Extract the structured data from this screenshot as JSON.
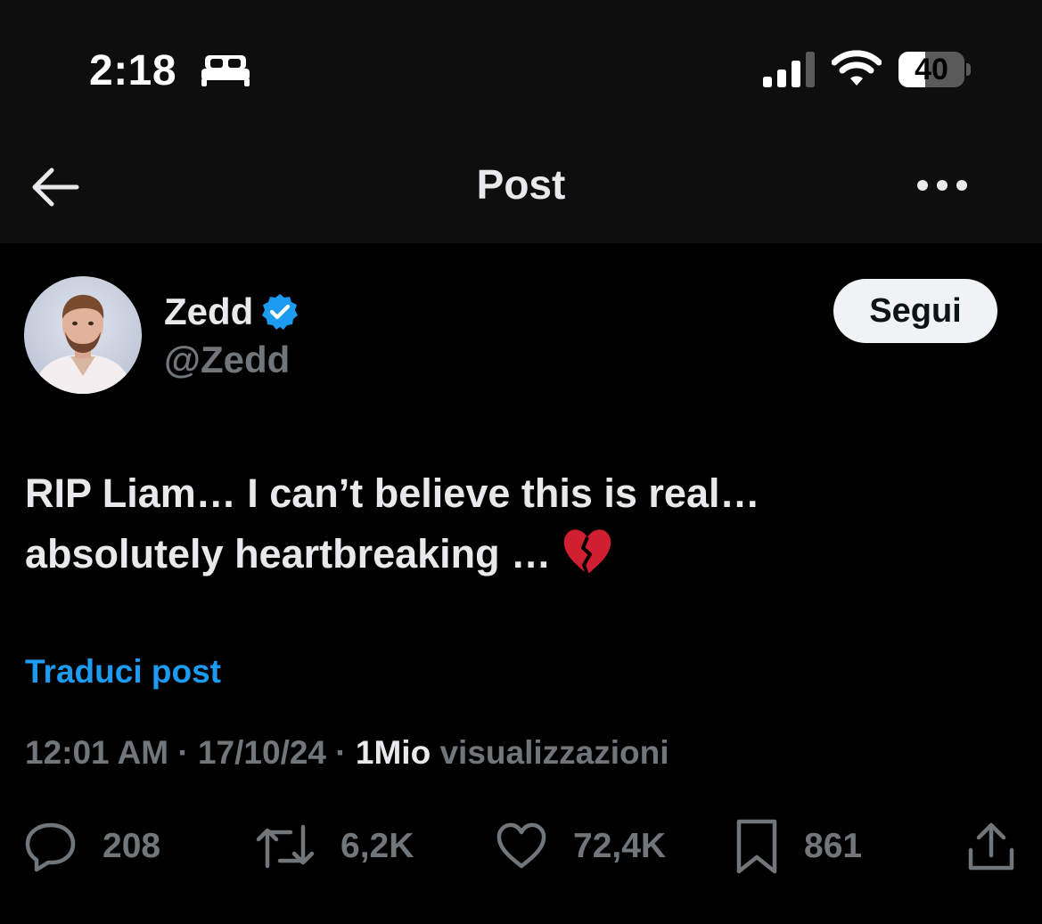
{
  "status_bar": {
    "time": "2:18",
    "focus_icon": "bed-icon",
    "signal_icon": "signal-bars-icon",
    "wifi_icon": "wifi-icon",
    "battery_level": "40",
    "battery_fraction": 0.4
  },
  "header": {
    "title": "Post",
    "back_icon": "arrow-left-icon",
    "more_icon": "more-horizontal-icon"
  },
  "author": {
    "display_name": "Zedd",
    "handle": "@Zedd",
    "verified": true,
    "verified_color": "#1d9bf0",
    "follow_label": "Segui"
  },
  "tweet": {
    "line1": "RIP Liam… I can’t believe this is real…",
    "line2": "absolutely heartbreaking …",
    "emoji_icon": "broken-heart-icon",
    "translate_label": "Traduci post"
  },
  "meta": {
    "time": "12:01 AM",
    "separator": " · ",
    "date": "17/10/24",
    "views_count": "1Mio",
    "views_label": " visualizzazioni"
  },
  "actions": {
    "replies": "208",
    "reposts": "6,2K",
    "likes": "72,4K",
    "bookmarks": "861"
  },
  "colors": {
    "background": "#000000",
    "bar_background": "#0e0e0e",
    "text_primary": "#e7e9ea",
    "text_secondary": "#71767b",
    "accent": "#1d9bf0"
  }
}
